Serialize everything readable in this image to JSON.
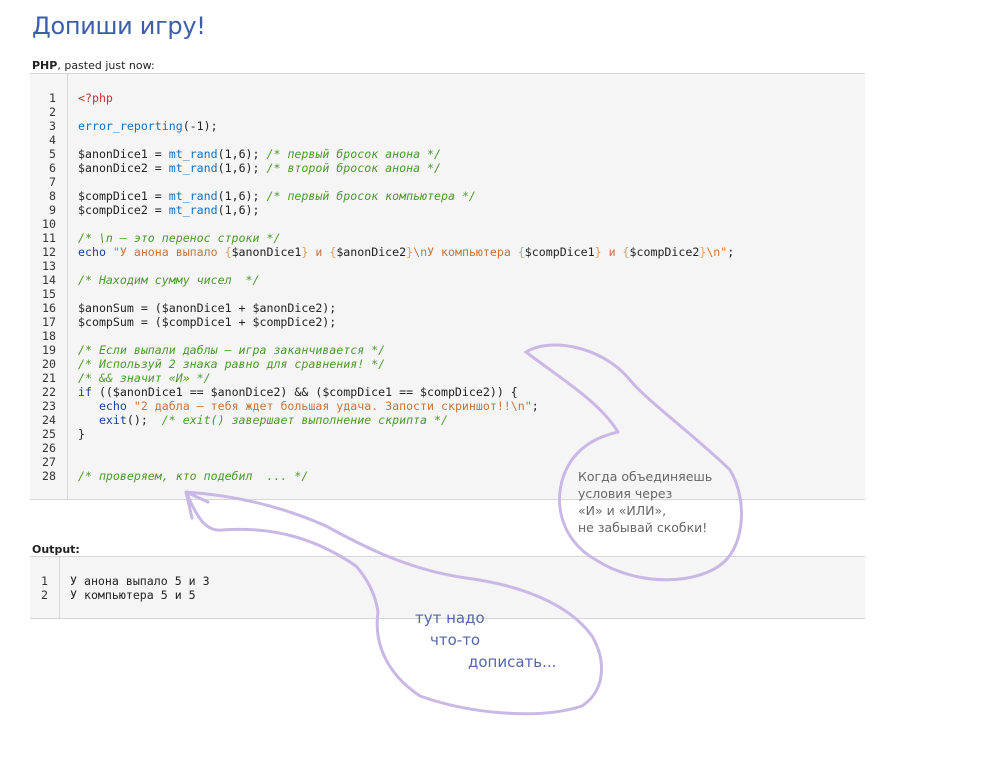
{
  "page": {
    "title": "Допиши игру!",
    "meta_lang": "PHP",
    "meta_rest": ", pasted just now:",
    "output_label": "Output:"
  },
  "code_lines": [
    [
      [
        "t",
        "<?php"
      ]
    ],
    [],
    [
      [
        "f",
        "error_reporting"
      ],
      [
        "p",
        "(-1);"
      ]
    ],
    [],
    [
      [
        "v",
        "$anonDice1 = "
      ],
      [
        "f",
        "mt_rand"
      ],
      [
        "p",
        "(1,6); "
      ],
      [
        "c",
        "/* первый бросок анона */"
      ]
    ],
    [
      [
        "v",
        "$anonDice2 = "
      ],
      [
        "f",
        "mt_rand"
      ],
      [
        "p",
        "(1,6); "
      ],
      [
        "c",
        "/* второй бросок анона */"
      ]
    ],
    [],
    [
      [
        "v",
        "$compDice1 = "
      ],
      [
        "f",
        "mt_rand"
      ],
      [
        "p",
        "(1,6); "
      ],
      [
        "c",
        "/* первый бросок компьютера */"
      ]
    ],
    [
      [
        "v",
        "$compDice2 = "
      ],
      [
        "f",
        "mt_rand"
      ],
      [
        "p",
        "(1,6);"
      ]
    ],
    [],
    [
      [
        "c",
        "/* \\n — это перенос строки */"
      ]
    ],
    [
      [
        "k",
        "echo "
      ],
      [
        "s",
        "\"У анона выпало "
      ],
      [
        "bb",
        "{"
      ],
      [
        "v",
        "$anonDice1"
      ],
      [
        "bb",
        "}"
      ],
      [
        "s",
        " и "
      ],
      [
        "bb",
        "{"
      ],
      [
        "v",
        "$anonDice2"
      ],
      [
        "bb",
        "}"
      ],
      [
        "s",
        "\\nУ компьютера "
      ],
      [
        "bb",
        "{"
      ],
      [
        "v",
        "$compDice1"
      ],
      [
        "bb",
        "}"
      ],
      [
        "s",
        " и "
      ],
      [
        "bb",
        "{"
      ],
      [
        "v",
        "$compDice2"
      ],
      [
        "bb",
        "}"
      ],
      [
        "s",
        "\\n\""
      ],
      [
        "p",
        ";"
      ]
    ],
    [],
    [
      [
        "c",
        "/* Находим сумму чисел  */"
      ]
    ],
    [],
    [
      [
        "v",
        "$anonSum = ($anonDice1 + $anonDice2);"
      ]
    ],
    [
      [
        "v",
        "$compSum = ($compDice1 + $compDice2);"
      ]
    ],
    [],
    [
      [
        "c",
        "/* Если выпали даблы — игра заканчивается */"
      ]
    ],
    [
      [
        "c",
        "/* Используй 2 знака равно для сравнения! */"
      ]
    ],
    [
      [
        "c",
        "/* && значит «И» */"
      ]
    ],
    [
      [
        "k",
        "if "
      ],
      [
        "p",
        "(($anonDice1 == $anonDice2) && ($compDice1 == $compDice2)) {"
      ]
    ],
    [
      [
        "p",
        "   "
      ],
      [
        "k",
        "echo "
      ],
      [
        "s",
        "\"2 дабла — тебя ждет большая удача. Запости скриншот!!\\n\""
      ],
      [
        "p",
        ";"
      ]
    ],
    [
      [
        "p",
        "   "
      ],
      [
        "k",
        "exit"
      ],
      [
        "p",
        "();  "
      ],
      [
        "c",
        "/* exit() завершает выполнение скрипта */"
      ]
    ],
    [
      [
        "p",
        "}"
      ]
    ],
    [],
    [],
    [
      [
        "c",
        "/* проверяем, кто подебил  ... */"
      ]
    ]
  ],
  "output_lines": [
    "У анона выпало 5 и 3",
    "У компьютера 5 и 5"
  ],
  "annotations": {
    "note_lines": [
      "Когда объединяешь",
      "условия через",
      "«И» и «ИЛИ»,",
      "не забывай скобки!"
    ],
    "hand_1": "тут надо",
    "hand_2": "что-то",
    "hand_3": "дописать...",
    "scribble_color": "#c9b8e6"
  }
}
